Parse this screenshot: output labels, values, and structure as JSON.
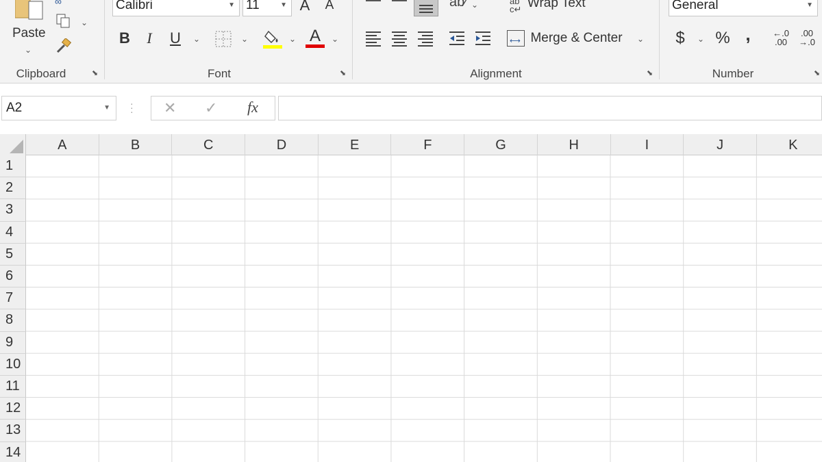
{
  "clipboard": {
    "paste_label": "Paste",
    "group_label": "Clipboard"
  },
  "font": {
    "font_name": "Calibri",
    "font_size": "11",
    "grow_label": "A",
    "shrink_label": "A",
    "bold_label": "B",
    "italic_label": "I",
    "underline_label": "U",
    "font_color_label": "A",
    "group_label": "Font",
    "fill_color": "#ffff00",
    "font_color": "#e00000"
  },
  "alignment": {
    "wrap_text_label": "Wrap Text",
    "merge_center_label": "Merge & Center",
    "group_label": "Alignment"
  },
  "number": {
    "format_value": "General",
    "currency_label": "$",
    "percent_label": "%",
    "comma_label": ",",
    "increase_decimal_top": "←.0",
    "increase_decimal_bottom": ".00",
    "decrease_decimal_top": ".00",
    "decrease_decimal_bottom": "→.0",
    "group_label": "Number"
  },
  "formula_bar": {
    "name_box_value": "A2",
    "cancel_label": "✕",
    "enter_label": "✓",
    "fx_label": "fx",
    "formula_value": ""
  },
  "grid": {
    "columns": [
      "A",
      "B",
      "C",
      "D",
      "E",
      "F",
      "G",
      "H",
      "I",
      "J",
      "K"
    ],
    "rows": [
      "1",
      "2",
      "3",
      "4",
      "5",
      "6",
      "7",
      "8",
      "9",
      "10",
      "11",
      "12",
      "13",
      "14"
    ]
  }
}
